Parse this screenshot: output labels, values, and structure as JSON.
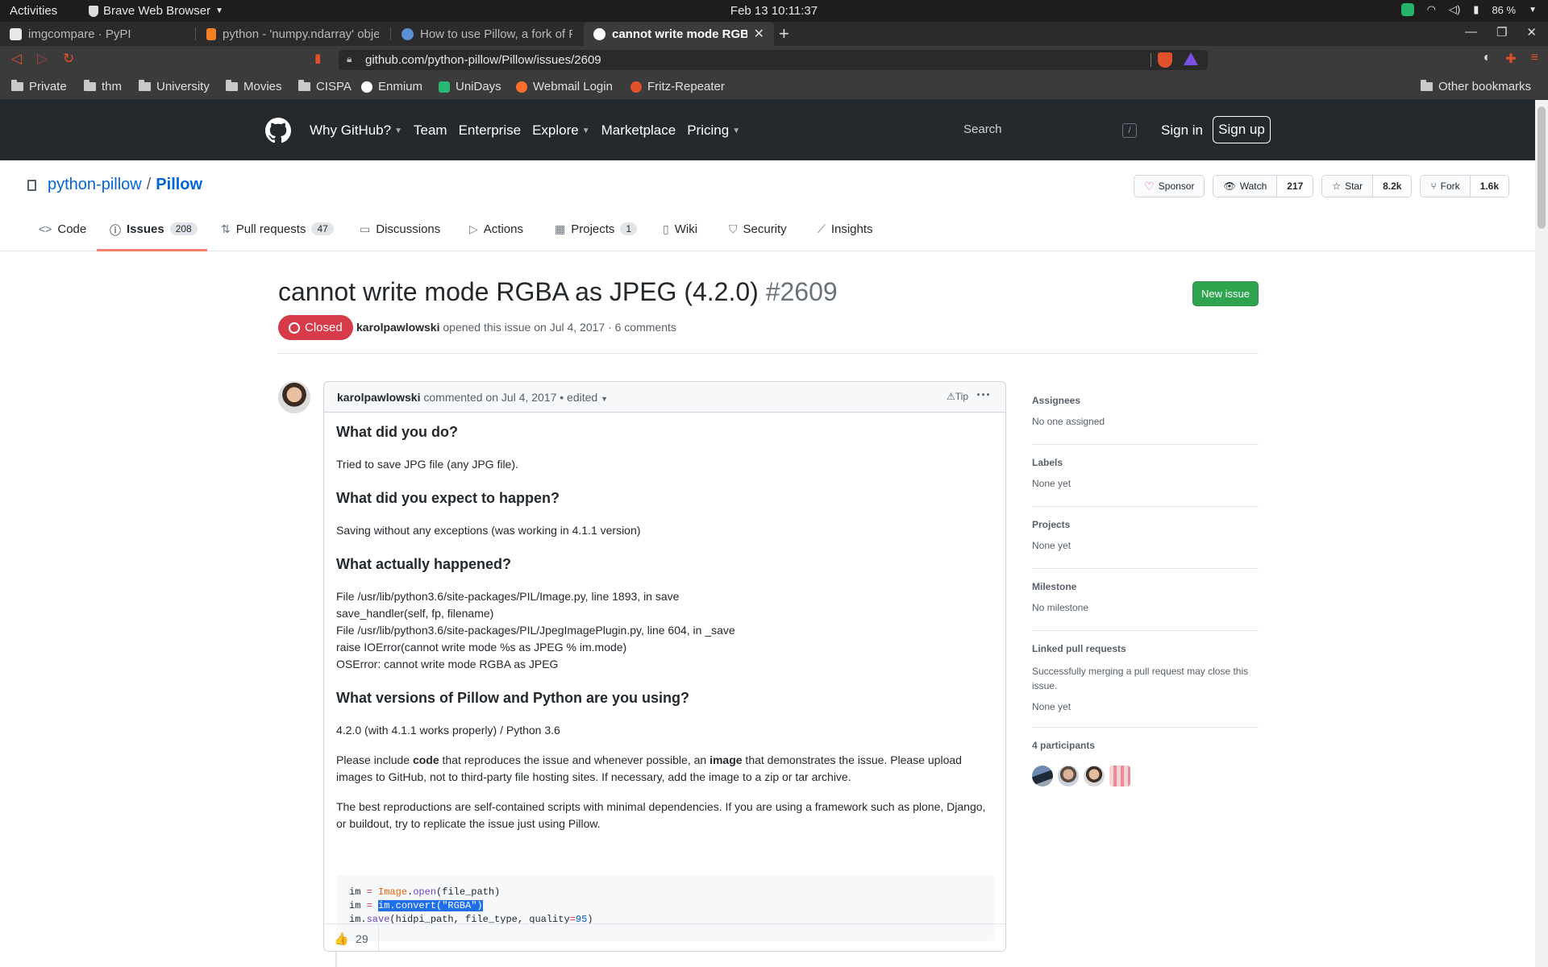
{
  "os": {
    "activities": "Activities",
    "app_name": "Brave Web Browser",
    "clock": "Feb 13  10:11:37",
    "battery": "86 %"
  },
  "tabs": [
    {
      "title": "imgcompare · PyPI"
    },
    {
      "title": "python - 'numpy.ndarray' obje"
    },
    {
      "title": "How to use Pillow, a fork of PI"
    },
    {
      "title": "cannot write mode RGBA a"
    }
  ],
  "address_bar": {
    "url": "github.com/python-pillow/Pillow/issues/2609",
    "shields_count": "3"
  },
  "bookmarks": [
    {
      "label": "Private",
      "icon": "folder-icon"
    },
    {
      "label": "thm",
      "icon": "folder-icon"
    },
    {
      "label": "University",
      "icon": "folder-icon"
    },
    {
      "label": "Movies",
      "icon": "folder-icon"
    },
    {
      "label": "CISPA",
      "icon": "folder-icon"
    },
    {
      "label": "Enmium",
      "icon": "site-icon"
    },
    {
      "label": "UniDays",
      "icon": "site-icon"
    },
    {
      "label": "Webmail Login",
      "icon": "site-icon"
    },
    {
      "label": "Fritz-Repeater",
      "icon": "site-icon"
    },
    {
      "label": "Other bookmarks",
      "icon": "folder-icon"
    }
  ],
  "github_header": {
    "nav": [
      "Why GitHub?",
      "Team",
      "Enterprise",
      "Explore",
      "Marketplace",
      "Pricing"
    ],
    "search_placeholder": "Search",
    "search_shortcut": "/",
    "sign_in": "Sign in",
    "sign_up": "Sign up"
  },
  "repo": {
    "owner": "python-pillow",
    "separator": "/",
    "name": "Pillow",
    "sponsor": "Sponsor",
    "watch": "Watch",
    "watch_count": "217",
    "star": "Star",
    "star_count": "8.2k",
    "fork": "Fork",
    "fork_count": "1.6k"
  },
  "repo_tabs": [
    {
      "label": "Code",
      "icon": "code-icon"
    },
    {
      "label": "Issues",
      "count": "208",
      "icon": "issue-icon"
    },
    {
      "label": "Pull requests",
      "count": "47",
      "icon": "pull-request-icon"
    },
    {
      "label": "Discussions",
      "icon": "discussion-icon"
    },
    {
      "label": "Actions",
      "icon": "play-icon"
    },
    {
      "label": "Projects",
      "count": "1",
      "icon": "project-icon"
    },
    {
      "label": "Wiki",
      "icon": "book-icon"
    },
    {
      "label": "Security",
      "icon": "shield-icon"
    },
    {
      "label": "Insights",
      "icon": "graph-icon"
    }
  ],
  "issue": {
    "title": "cannot write mode RGBA as JPEG (4.2.0)",
    "number": "#2609",
    "new_issue": "New issue",
    "state": "Closed",
    "author": "karolpawlowski",
    "opened_text": "opened this issue on Jul 4, 2017 · 6 comments"
  },
  "comment": {
    "author": "karolpawlowski",
    "meta": "commented on Jul 4, 2017 • edited",
    "tip": "Tip",
    "h1": "What did you do?",
    "p1": "Tried to save JPG file (any JPG file).",
    "h2": "What did you expect to happen?",
    "p2": "Saving without any exceptions (was working in 4.1.1 version)",
    "h3": "What actually happened?",
    "trace": [
      "File /usr/lib/python3.6/site-packages/PIL/Image.py, line 1893, in save",
      "save_handler(self, fp, filename)",
      "File /usr/lib/python3.6/site-packages/PIL/JpegImagePlugin.py, line 604, in _save",
      "raise IOError(cannot write mode %s as JPEG % im.mode)",
      "OSError: cannot write mode RGBA as JPEG"
    ],
    "h4": "What versions of Pillow and Python are you using?",
    "p4": "4.2.0 (with 4.1.1 works properly) / Python 3.6",
    "p5_a": "Please include ",
    "p5_b": "code",
    "p5_c": " that reproduces the issue and whenever possible, an ",
    "p5_d": "image",
    "p5_e": " that demonstrates the issue. Please upload images to GitHub, not to third-party file hosting sites. If necessary, add the image to a zip or tar archive.",
    "p6": "The best reproductions are self-contained scripts with minimal dependencies. If you are using a framework such as plone, Django, or buildout, try to replicate the issue just using Pillow.",
    "code": {
      "l1_a": "im ",
      "l1_op": "=",
      "l1_cls": "Image",
      "l1_dot": ".",
      "l1_fn": "open",
      "l1_rest": "(file_path)",
      "l2_a": "im ",
      "l2_op": "=",
      "l2_sel": "im.convert(\"RGBA\")",
      "l3_a": "im.",
      "l3_fn": "save",
      "l3_b": "(hidpi_path, file_type, quality",
      "l3_op": "=",
      "l3_num": "95",
      "l3_c": ")"
    },
    "reaction_emoji": "👍",
    "reaction_count": "29"
  },
  "sidebar": {
    "assignees_h": "Assignees",
    "assignees_v": "No one assigned",
    "labels_h": "Labels",
    "labels_v": "None yet",
    "projects_h": "Projects",
    "projects_v": "None yet",
    "milestone_h": "Milestone",
    "milestone_v": "No milestone",
    "linked_h": "Linked pull requests",
    "linked_desc": "Successfully merging a pull request may close this issue.",
    "linked_v": "None yet",
    "participants_h": "4 participants"
  },
  "colors": {
    "github_header": "#24292e",
    "link": "#0366d6",
    "closed_badge": "#d73a49",
    "new_issue": "#2ea44f",
    "active_tab_underline": "#f9826c"
  }
}
